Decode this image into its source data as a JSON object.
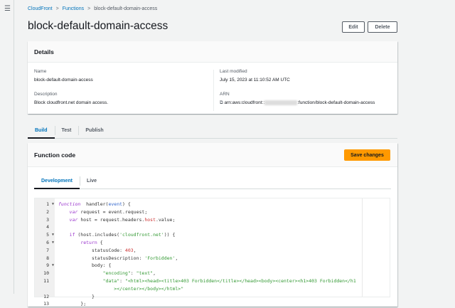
{
  "breadcrumb": [
    "CloudFront",
    "Functions",
    "block-default-domain-access"
  ],
  "title": "block-default-domain-access",
  "buttons": {
    "edit": "Edit",
    "delete": "Delete",
    "save": "Save changes"
  },
  "details": {
    "heading": "Details",
    "name_label": "Name",
    "name": "block-default-domain-access",
    "desc_label": "Description",
    "desc": "Block cloudfront.net domain access.",
    "modified_label": "Last modified",
    "modified": "July 15, 2023 at 11:10:52 AM UTC",
    "arn_label": "ARN",
    "arn_prefix": "arn:aws:cloudfront::",
    "arn_suffix": ":function/block-default-domain-access"
  },
  "tabs": [
    "Build",
    "Test",
    "Publish"
  ],
  "function_code": {
    "heading": "Function code",
    "subtabs": [
      "Development",
      "Live"
    ]
  },
  "code": [
    {
      "n": "1",
      "f": true,
      "t": [
        [
          "kw",
          "function"
        ],
        [
          "",
          "  handler("
        ],
        [
          "pa",
          "event"
        ],
        [
          "",
          ") {"
        ]
      ]
    },
    {
      "n": "2",
      "t": [
        [
          "",
          "    "
        ],
        [
          "kw",
          "var"
        ],
        [
          "",
          " request = event.request;"
        ]
      ]
    },
    {
      "n": "3",
      "t": [
        [
          "",
          "    "
        ],
        [
          "kw",
          "var"
        ],
        [
          "",
          " host = request.headers."
        ],
        [
          "pr",
          "host"
        ],
        [
          "",
          ".value;"
        ]
      ]
    },
    {
      "n": "4",
      "t": []
    },
    {
      "n": "5",
      "f": true,
      "t": [
        [
          "",
          "    "
        ],
        [
          "kw2",
          "if"
        ],
        [
          "",
          " (host.includes("
        ],
        [
          "st",
          "'cloudfront.net'"
        ],
        [
          "",
          ")) {"
        ]
      ]
    },
    {
      "n": "6",
      "f": true,
      "t": [
        [
          "",
          "        "
        ],
        [
          "kw2",
          "return"
        ],
        [
          "",
          " {"
        ]
      ]
    },
    {
      "n": "7",
      "t": [
        [
          "",
          "            statusCode: "
        ],
        [
          "nu",
          "403"
        ],
        [
          "",
          ","
        ]
      ]
    },
    {
      "n": "8",
      "t": [
        [
          "",
          "            statusDescription: "
        ],
        [
          "st",
          "'Forbidden'"
        ],
        [
          "",
          ","
        ]
      ]
    },
    {
      "n": "9",
      "f": true,
      "t": [
        [
          "",
          "            body: {"
        ]
      ]
    },
    {
      "n": "10",
      "t": [
        [
          "",
          "                "
        ],
        [
          "st",
          "\"encoding\""
        ],
        [
          "",
          ": "
        ],
        [
          "st",
          "\"text\""
        ],
        [
          "",
          ","
        ]
      ]
    },
    {
      "n": "11",
      "t": [
        [
          "",
          "                "
        ],
        [
          "st",
          "\"data\""
        ],
        [
          "",
          ": "
        ],
        [
          "st",
          "\"<html><head><title>403 Forbidden</title></head><body><center><h1>403 Forbidden</h1"
        ]
      ]
    },
    {
      "n": "",
      "t": [
        [
          "",
          "                    "
        ],
        [
          "st",
          "></center></body></html>\""
        ]
      ]
    },
    {
      "n": "12",
      "t": [
        [
          "",
          "            }"
        ]
      ]
    },
    {
      "n": "13",
      "t": [
        [
          "",
          "        };"
        ]
      ]
    }
  ]
}
